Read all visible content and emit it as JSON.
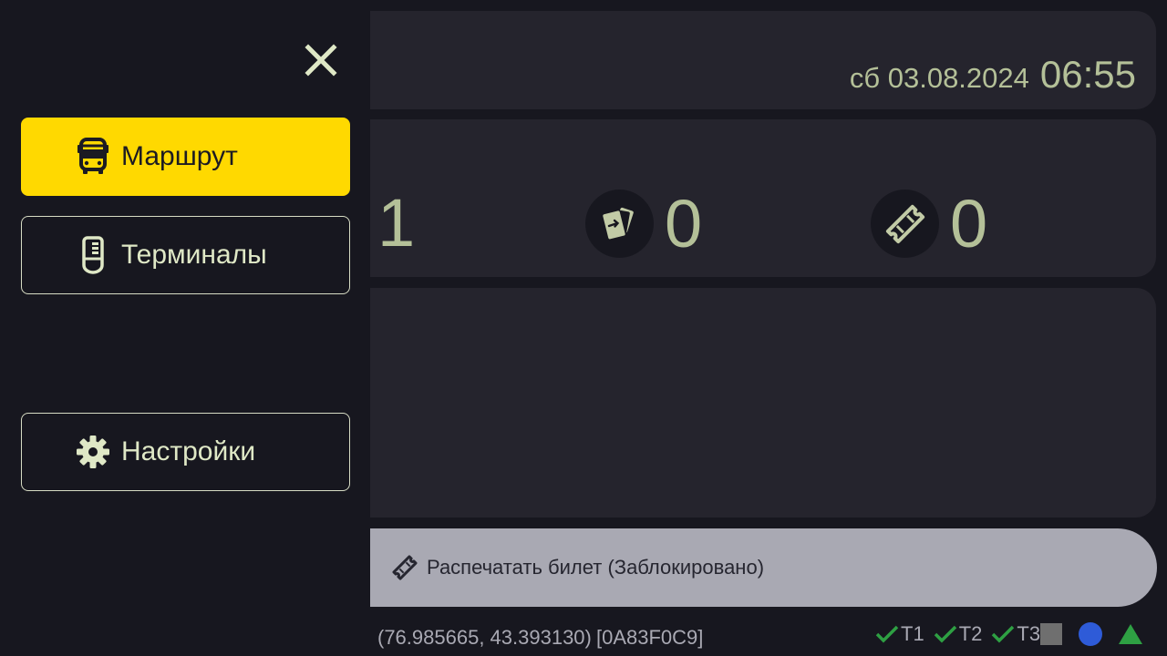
{
  "header": {
    "date": "сб 03.08.2024",
    "time": "06:55"
  },
  "stats": [
    {
      "value": "1"
    },
    {
      "icon": "cards-transfer-icon",
      "value": "0"
    },
    {
      "icon": "ticket-icon",
      "value": "0"
    }
  ],
  "print_button": {
    "label": "Распечатать билет (Заблокировано)"
  },
  "statusbar": {
    "coords": "(76.985665, 43.393130)",
    "device_id": "[0A83F0C9]",
    "terminals": [
      "T1",
      "T2",
      "T3"
    ]
  },
  "drawer": {
    "items": [
      {
        "label": "Маршрут",
        "icon": "bus-icon",
        "active": true
      },
      {
        "label": "Терминалы",
        "icon": "terminal-icon",
        "active": false
      },
      {
        "label": "Настройки",
        "icon": "gear-icon",
        "active": false
      }
    ]
  },
  "colors": {
    "accent": "#ffd900",
    "text": "#b4c098",
    "ok": "#2ea043",
    "blue": "#2e5bd8"
  }
}
